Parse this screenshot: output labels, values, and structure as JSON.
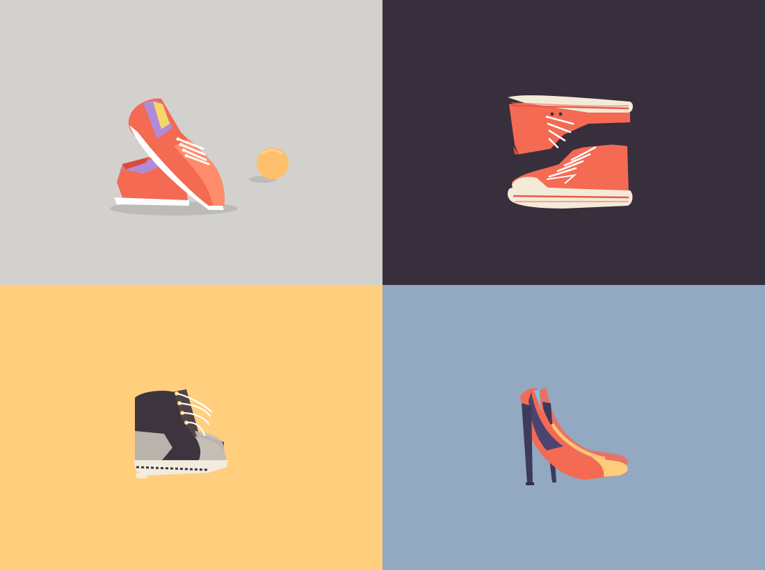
{
  "panels": [
    {
      "id": "sneakers",
      "background": "#d3d1cd",
      "illustration": "low-top-sneakers-pair",
      "extras": [
        "ball"
      ],
      "colors": {
        "upper": "#f46a52",
        "toe": "#ff8c6b",
        "sole": "#ffffff",
        "lining": "#b28bd8",
        "insole": "#f5d66a",
        "ball": "#ffc06e"
      }
    },
    {
      "id": "high-tops",
      "background": "#382f3c",
      "illustration": "high-top-sneakers-pair",
      "colors": {
        "upper": "#f46a52",
        "sole": "#f4ead8",
        "stripe": "#e8594a",
        "laces": "#ffffff"
      }
    },
    {
      "id": "boots",
      "background": "#ffcf7e",
      "illustration": "lace-up-boots-pair",
      "colors": {
        "upper": "#3d3440",
        "panel": "#b9b3ab",
        "toe": "#c4beb6",
        "sole": "#f1ecde",
        "laces": "#ffffff"
      }
    },
    {
      "id": "heels",
      "background": "#93a8c1",
      "illustration": "stiletto-heels-pair",
      "colors": {
        "upper": "#f46a52",
        "toe": "#ffcd7a",
        "lining": "#4b4470",
        "heel": "#3d3a5c",
        "accent": "#7fc2e6"
      }
    }
  ]
}
